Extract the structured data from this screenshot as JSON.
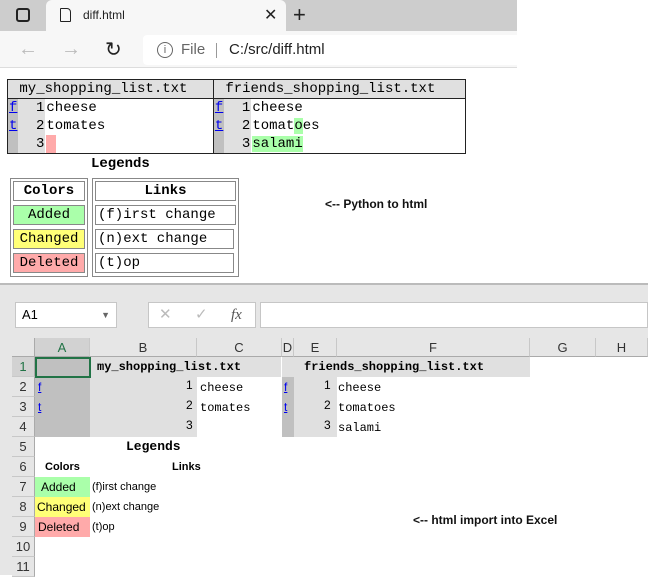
{
  "browser": {
    "tab_title": "diff.html",
    "address_scheme": "File",
    "address_url": "C:/src/diff.html"
  },
  "diff": {
    "left_file": "my_shopping_list.txt",
    "right_file": "friends_shopping_list.txt",
    "nav_first": "f",
    "nav_top": "t",
    "left_lines": [
      {
        "num": "1",
        "text": "cheese"
      },
      {
        "num": "2",
        "text": "tomates"
      },
      {
        "num": "3",
        "text": ""
      }
    ],
    "right_lines": [
      {
        "num": "1",
        "text": "cheese"
      },
      {
        "num": "2",
        "pre": "tomat",
        "added": "o",
        "post": "es"
      },
      {
        "num": "3",
        "text": "salami"
      }
    ]
  },
  "legend": {
    "title": "Legends",
    "colors_header": "Colors",
    "links_header": "Links",
    "added": "Added",
    "changed": "Changed",
    "deleted": "Deleted",
    "first": "(f)irst change",
    "next": "(n)ext change",
    "top": "(t)op",
    "colors": {
      "added": "#aaffaa",
      "changed": "#ffff77",
      "deleted": "#ffaaaa"
    }
  },
  "notes": {
    "python": "<-- Python to html",
    "excel": "<-- html import into Excel"
  },
  "excel": {
    "name_box": "A1",
    "fx": "fx",
    "columns": [
      "A",
      "B",
      "C",
      "D",
      "E",
      "F",
      "G",
      "H"
    ],
    "rows": [
      "1",
      "2",
      "3",
      "4",
      "5",
      "6",
      "7",
      "8",
      "9",
      "10",
      "11"
    ]
  }
}
